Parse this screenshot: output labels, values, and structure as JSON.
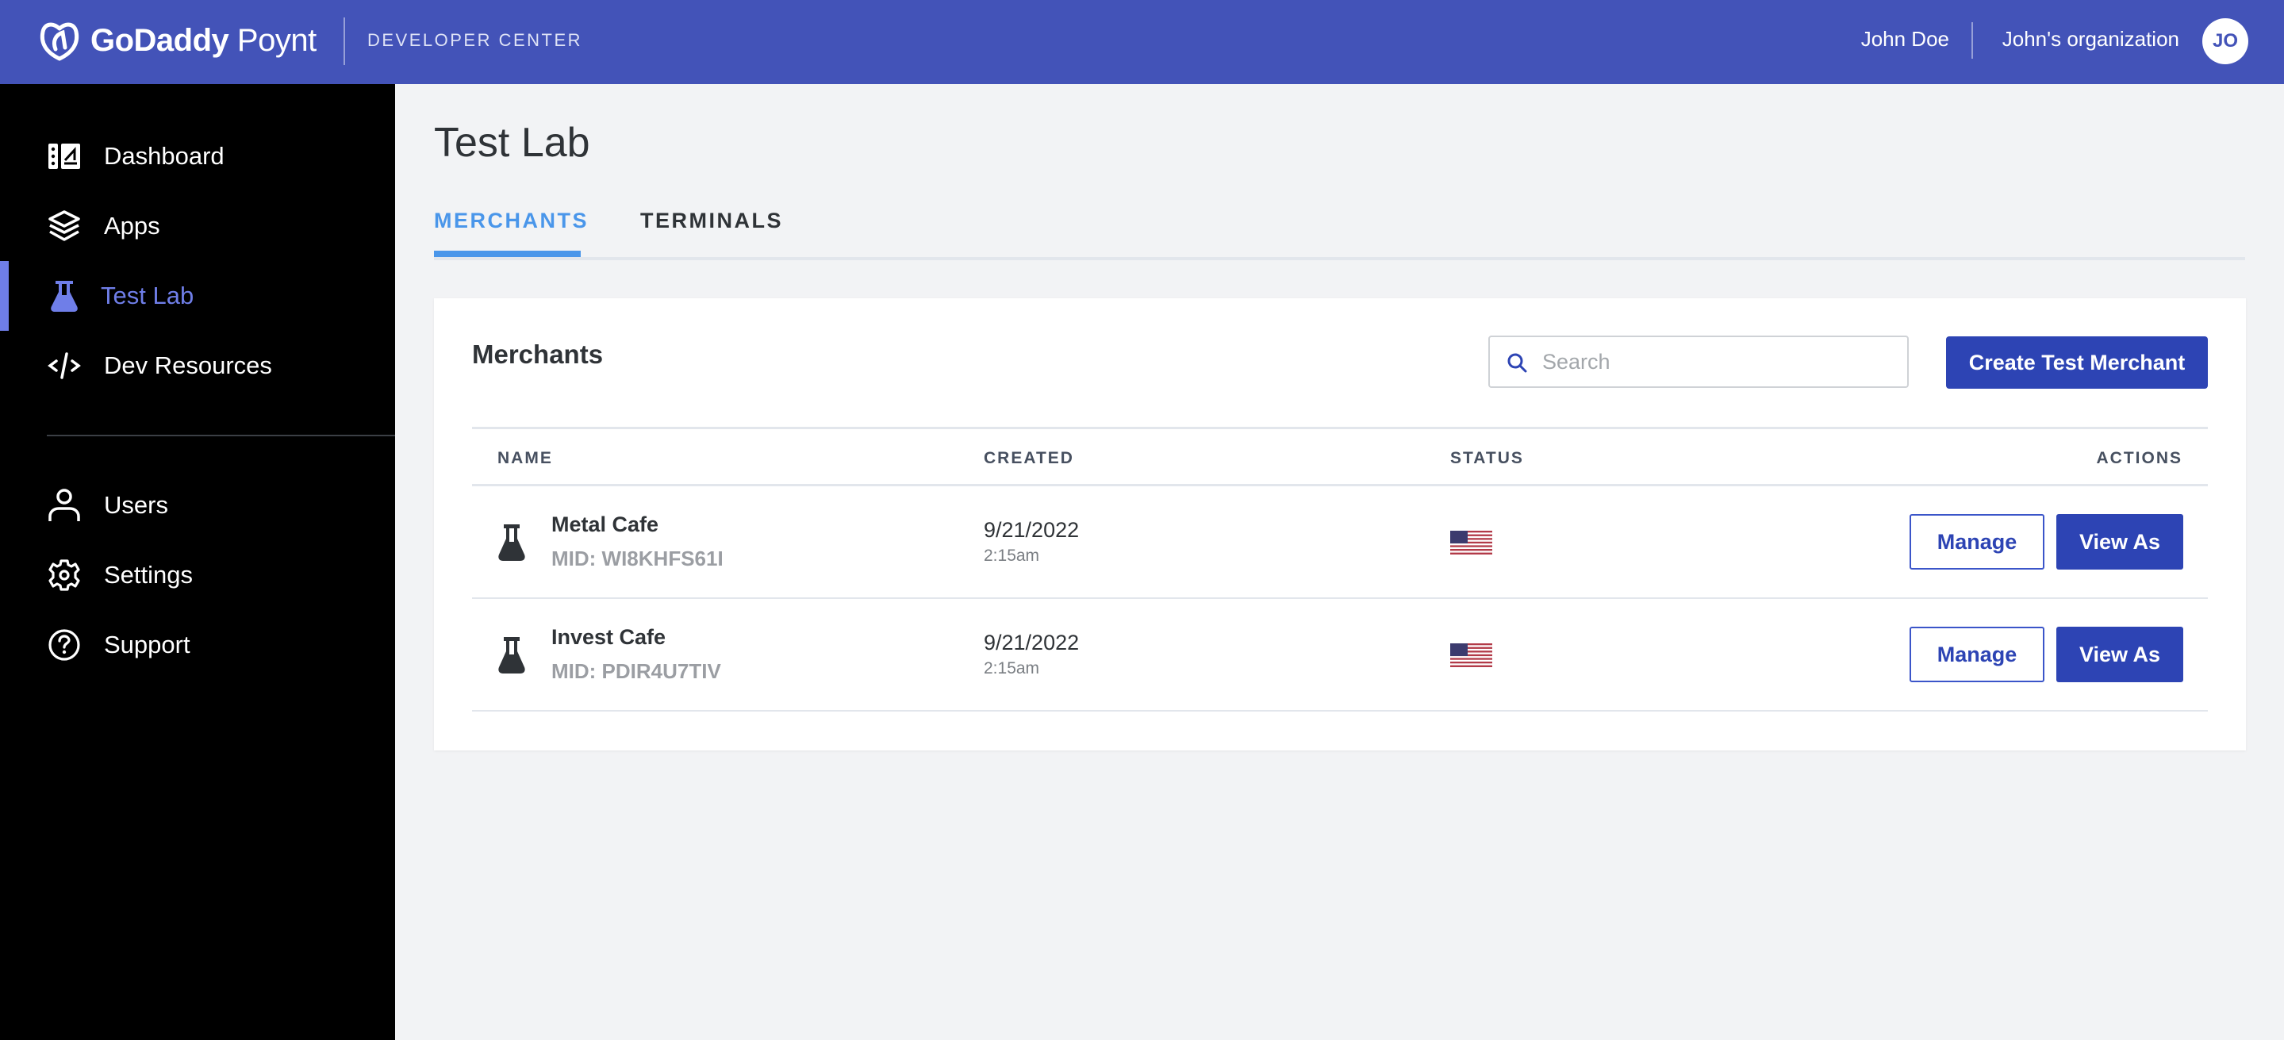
{
  "header": {
    "brand_bold": "GoDaddy",
    "brand_light": "Poynt",
    "section": "DEVELOPER CENTER",
    "user_name": "John Doe",
    "org_name": "John's organization",
    "avatar_initials": "JO",
    "colors": {
      "bar": "#4353b8"
    }
  },
  "sidebar": {
    "items": [
      {
        "label": "Dashboard",
        "icon": "dashboard-icon",
        "active": false
      },
      {
        "label": "Apps",
        "icon": "layers-icon",
        "active": false
      },
      {
        "label": "Test Lab",
        "icon": "flask-icon",
        "active": true
      },
      {
        "label": "Dev Resources",
        "icon": "code-icon",
        "active": false
      },
      {
        "label": "Users",
        "icon": "user-icon",
        "active": false
      },
      {
        "label": "Settings",
        "icon": "gear-icon",
        "active": false
      },
      {
        "label": "Support",
        "icon": "help-icon",
        "active": false
      }
    ],
    "colors": {
      "active": "#6f7ee8"
    }
  },
  "main": {
    "title": "Test Lab",
    "tabs": [
      {
        "label": "MERCHANTS",
        "active": true
      },
      {
        "label": "TERMINALS",
        "active": false
      }
    ],
    "card": {
      "title": "Merchants",
      "search": {
        "placeholder": "Search",
        "value": ""
      },
      "create_button": "Create Test Merchant",
      "columns": [
        "NAME",
        "CREATED",
        "STATUS",
        "ACTIONS"
      ],
      "rows": [
        {
          "name": "Metal Cafe",
          "mid": "MID: WI8KHFS61I",
          "date": "9/21/2022",
          "time": "2:15am",
          "status_icon": "us-flag-icon",
          "manage": "Manage",
          "view_as": "View As"
        },
        {
          "name": "Invest Cafe",
          "mid": "MID: PDIR4U7TIV",
          "date": "9/21/2022",
          "time": "2:15am",
          "status_icon": "us-flag-icon",
          "manage": "Manage",
          "view_as": "View As"
        }
      ]
    },
    "colors": {
      "primary_button": "#2d44b4",
      "tab_active": "#4a96ea"
    }
  }
}
